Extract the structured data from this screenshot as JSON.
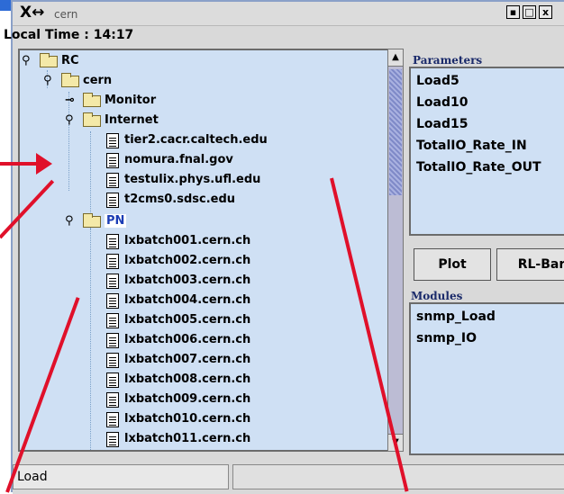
{
  "window": {
    "logo": "X↔",
    "title": "cern",
    "controls": [
      "▪",
      "□",
      "x"
    ]
  },
  "header": {
    "local_time": "Local Time : 14:17"
  },
  "tree": {
    "root": "RC",
    "group": "cern",
    "monitor": "Monitor",
    "internet": "Internet",
    "internet_hosts": [
      "tier2.cacr.caltech.edu",
      "nomura.fnal.gov",
      "testulix.phys.ufl.edu",
      "t2cms0.sdsc.edu"
    ],
    "pn": "PN",
    "pn_hosts": [
      "lxbatch001.cern.ch",
      "lxbatch002.cern.ch",
      "lxbatch003.cern.ch",
      "lxbatch004.cern.ch",
      "lxbatch005.cern.ch",
      "lxbatch006.cern.ch",
      "lxbatch007.cern.ch",
      "lxbatch008.cern.ch",
      "lxbatch009.cern.ch",
      "lxbatch010.cern.ch",
      "lxbatch011.cern.ch"
    ]
  },
  "parameters": {
    "heading": "Parameters",
    "items": [
      "Load5",
      "Load10",
      "Load15",
      "TotalIO_Rate_IN",
      "TotalIO_Rate_OUT"
    ]
  },
  "buttons": {
    "plot": "Plot",
    "rl_bar": "RL-Bar"
  },
  "modules": {
    "heading": "Modules",
    "items": [
      "snmp_Load",
      "snmp_IO"
    ]
  },
  "status": {
    "text": "Load"
  },
  "colors": {
    "accent": "#e0102a",
    "panel": "#cfe0f4",
    "selection": "#1b3db5"
  }
}
